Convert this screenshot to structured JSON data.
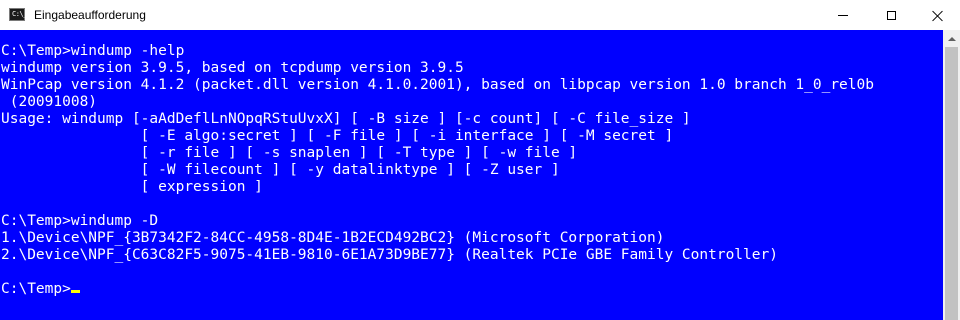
{
  "window": {
    "title": "Eingabeaufforderung",
    "app_icon_text": "C:\\_"
  },
  "colors": {
    "console_background": "#0000ff",
    "console_text": "#ffffff",
    "cursor": "#ffff00"
  },
  "console": {
    "lines": [
      "C:\\Temp>windump -help",
      "windump version 3.9.5, based on tcpdump version 3.9.5",
      "WinPcap version 4.1.2 (packet.dll version 4.1.0.2001), based on libpcap version 1.0 branch 1_0_rel0b",
      " (20091008)",
      "Usage: windump [-aAdDeflLnNOpqRStuUvxX] [ -B size ] [-c count] [ -C file_size ]",
      "                [ -E algo:secret ] [ -F file ] [ -i interface ] [ -M secret ]",
      "                [ -r file ] [ -s snaplen ] [ -T type ] [ -w file ]",
      "                [ -W filecount ] [ -y datalinktype ] [ -Z user ]",
      "                [ expression ]",
      "",
      "C:\\Temp>windump -D",
      "1.\\Device\\NPF_{3B7342F2-84CC-4958-8D4E-1B2ECD492BC2} (Microsoft Corporation)",
      "2.\\Device\\NPF_{C63C82F5-9075-41EB-9810-6E1A73D9BE77} (Realtek PCIe GBE Family Controller)",
      ""
    ],
    "prompt": "C:\\Temp>"
  }
}
